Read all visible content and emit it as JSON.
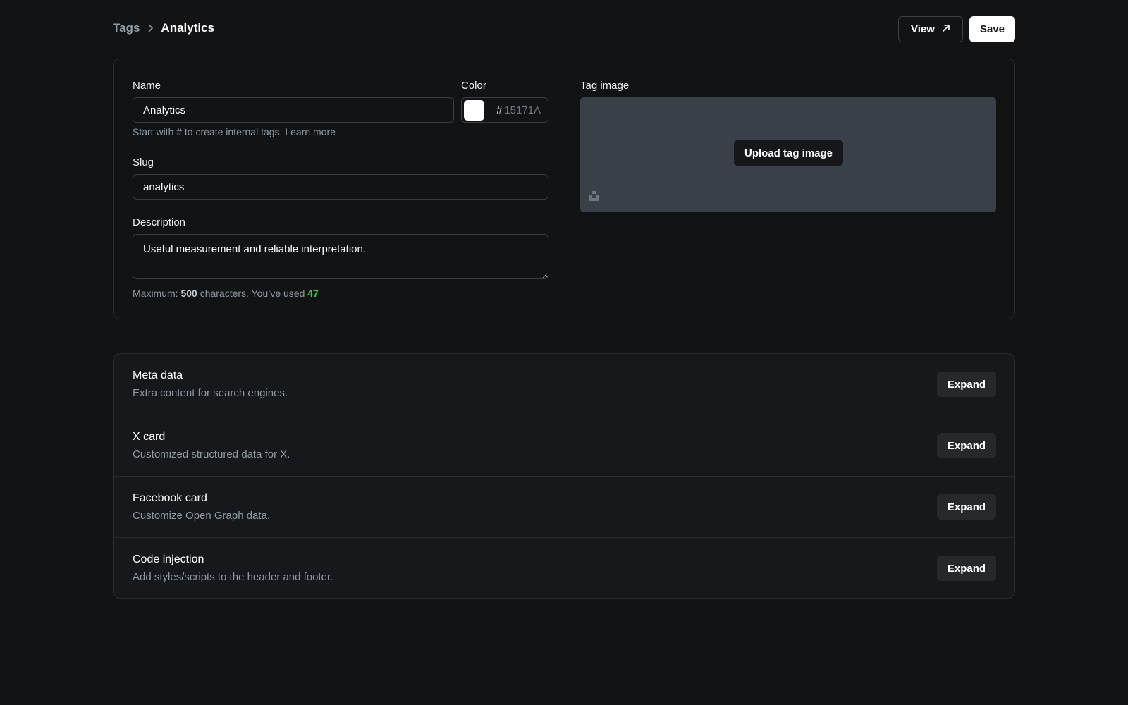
{
  "breadcrumb": {
    "parent": "Tags",
    "current": "Analytics"
  },
  "actions": {
    "view_label": "View",
    "save_label": "Save"
  },
  "form": {
    "name_label": "Name",
    "name_value": "Analytics",
    "name_hint": "Start with # to create internal tags.",
    "name_hint_link": "Learn more",
    "color_label": "Color",
    "color_hash": "#",
    "color_placeholder": "15171A",
    "color_swatch": "#ffffff",
    "slug_label": "Slug",
    "slug_value": "analytics",
    "description_label": "Description",
    "description_value": "Useful measurement and reliable interpretation.",
    "counter_prefix": "Maximum:",
    "counter_max": "500",
    "counter_middle": "characters. You’ve used",
    "counter_used": "47"
  },
  "tag_image": {
    "label": "Tag image",
    "upload_label": "Upload tag image",
    "unsplash_icon": "unsplash-icon"
  },
  "settings": [
    {
      "title": "Meta data",
      "description": "Extra content for search engines.",
      "button": "Expand"
    },
    {
      "title": "X card",
      "description": "Customized structured data for X.",
      "button": "Expand"
    },
    {
      "title": "Facebook card",
      "description": "Customize Open Graph data.",
      "button": "Expand"
    },
    {
      "title": "Code injection",
      "description": "Add styles/scripts to the header and footer.",
      "button": "Expand"
    }
  ],
  "colors": {
    "background": "#121315",
    "accent_green": "#30cf43",
    "image_placeholder": "#394047"
  }
}
